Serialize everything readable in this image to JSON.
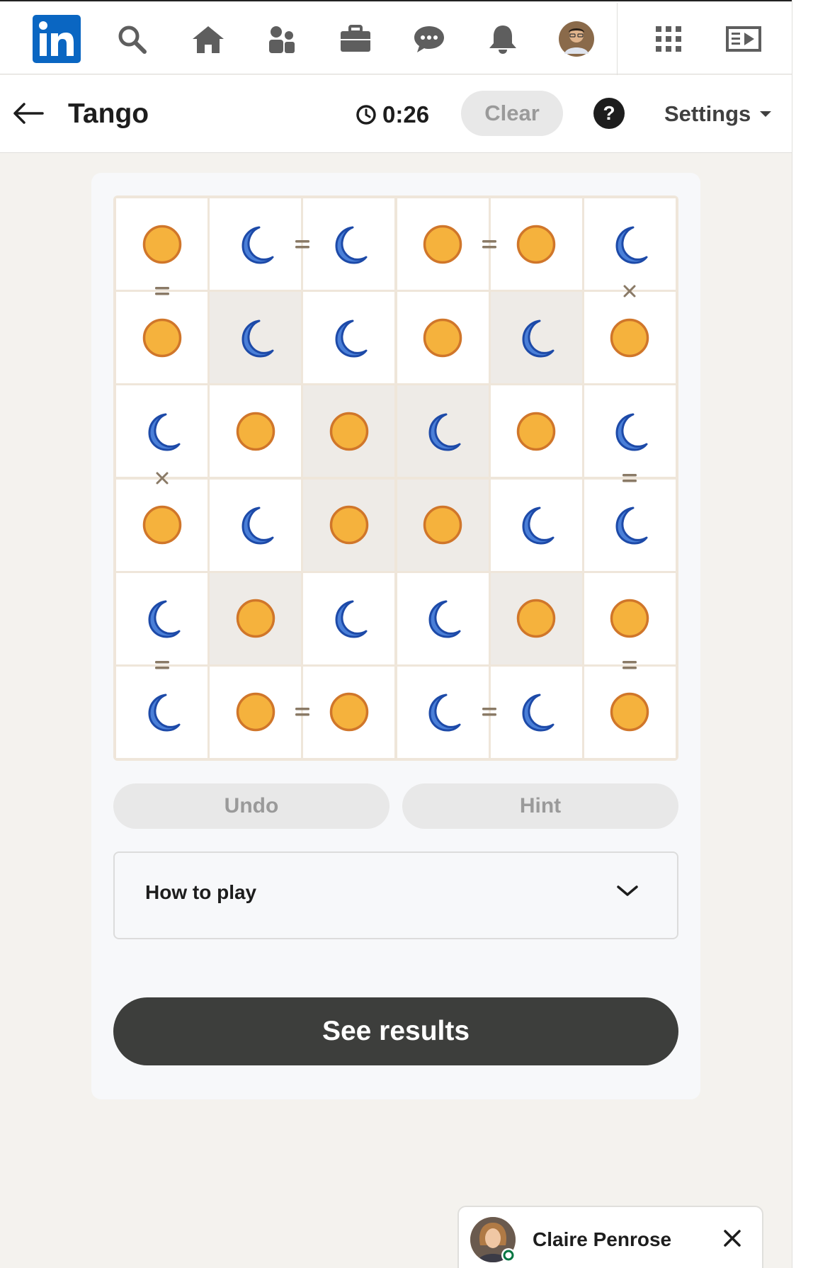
{
  "topnav": {
    "logo_text": "in",
    "items": [
      {
        "name": "search-icon"
      },
      {
        "name": "home-icon"
      },
      {
        "name": "my-network-icon"
      },
      {
        "name": "jobs-icon"
      },
      {
        "name": "messaging-icon"
      },
      {
        "name": "notifications-icon"
      },
      {
        "name": "profile-avatar"
      },
      {
        "name": "work-grid-icon"
      },
      {
        "name": "learning-icon"
      }
    ],
    "brand_color": "#0a66c2"
  },
  "game": {
    "title": "Tango",
    "timer": "0:26",
    "clear_label": "Clear",
    "help_label": "?",
    "settings_label": "Settings"
  },
  "board": {
    "size": 6,
    "grid": [
      [
        "sun",
        "moon",
        "moon",
        "sun",
        "sun",
        "moon"
      ],
      [
        "sun",
        "moon",
        "moon",
        "sun",
        "moon",
        "sun"
      ],
      [
        "moon",
        "sun",
        "sun",
        "moon",
        "sun",
        "moon"
      ],
      [
        "sun",
        "moon",
        "sun",
        "sun",
        "moon",
        "moon"
      ],
      [
        "moon",
        "sun",
        "moon",
        "moon",
        "sun",
        "sun"
      ],
      [
        "moon",
        "sun",
        "sun",
        "moon",
        "moon",
        "sun"
      ]
    ],
    "locked": [
      [
        false,
        false,
        false,
        false,
        false,
        false
      ],
      [
        false,
        true,
        false,
        false,
        true,
        false
      ],
      [
        false,
        false,
        true,
        true,
        false,
        false
      ],
      [
        false,
        false,
        true,
        true,
        false,
        false
      ],
      [
        false,
        true,
        false,
        false,
        true,
        false
      ],
      [
        false,
        false,
        false,
        false,
        false,
        false
      ]
    ],
    "h_constraints": [
      {
        "row": 0,
        "col": 1,
        "sign": "="
      },
      {
        "row": 0,
        "col": 3,
        "sign": "="
      },
      {
        "row": 5,
        "col": 1,
        "sign": "="
      },
      {
        "row": 5,
        "col": 3,
        "sign": "="
      }
    ],
    "v_constraints": [
      {
        "row": 0,
        "col": 0,
        "sign": "="
      },
      {
        "row": 0,
        "col": 5,
        "sign": "×"
      },
      {
        "row": 2,
        "col": 0,
        "sign": "×"
      },
      {
        "row": 2,
        "col": 5,
        "sign": "="
      },
      {
        "row": 4,
        "col": 0,
        "sign": "="
      },
      {
        "row": 4,
        "col": 5,
        "sign": "="
      }
    ],
    "colors": {
      "sun": "#f5b23d",
      "sun_border": "#d0762a",
      "moon": "#4a7fd8",
      "moon_border": "#1d4aa8",
      "sign": "#8a7a66"
    }
  },
  "actions": {
    "undo_label": "Undo",
    "hint_label": "Hint"
  },
  "howto": {
    "label": "How to play"
  },
  "results": {
    "label": "See results"
  },
  "chat": {
    "name": "Claire Penrose"
  }
}
